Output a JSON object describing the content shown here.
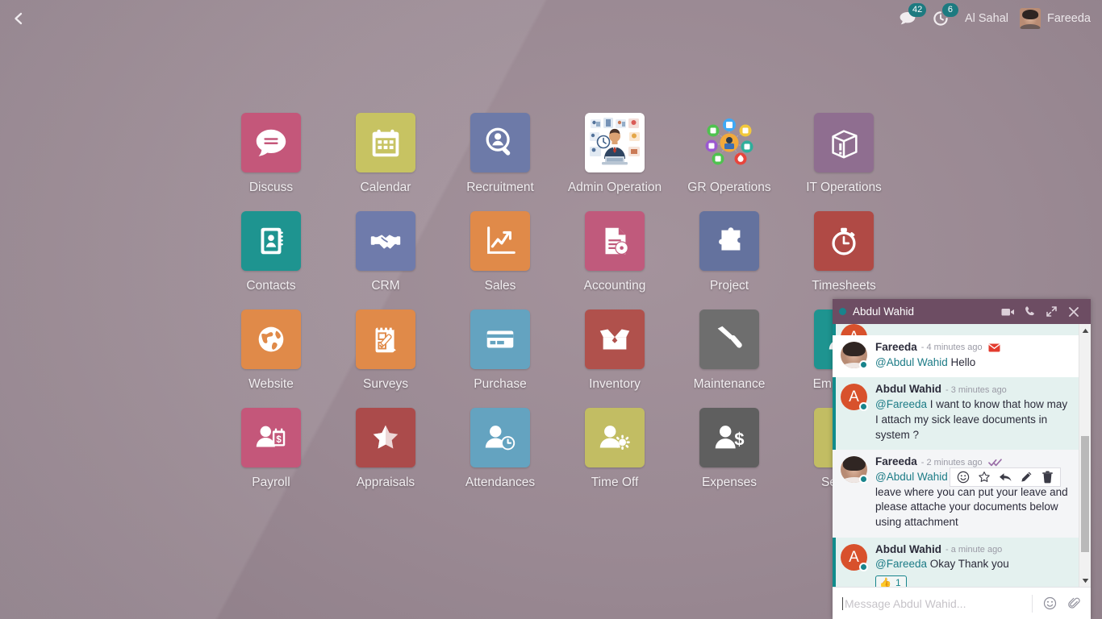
{
  "topbar": {
    "back_icon": "chevron-left-icon",
    "messages_icon": "comment-icon",
    "messages_badge": "42",
    "activities_icon": "clock-activity-icon",
    "activities_badge": "6",
    "company": "Al Sahal",
    "user": "Fareeda",
    "accent": "#1d7a80"
  },
  "apps": [
    {
      "label": "Discuss",
      "icon": "discuss-icon",
      "color": "#c4577a"
    },
    {
      "label": "Calendar",
      "icon": "calendar-icon",
      "color": "#c7c362"
    },
    {
      "label": "Recruitment",
      "icon": "recruitment-icon",
      "color": "#6d7aa8"
    },
    {
      "label": "Admin Operation",
      "icon": "admin-operation-icon",
      "color": "#ffffff"
    },
    {
      "label": "GR Operations",
      "icon": "gr-operations-icon",
      "color": "transparent"
    },
    {
      "label": "IT Operations",
      "icon": "it-operations-icon",
      "color": "#8f6e90"
    },
    {
      "label": "Contacts",
      "icon": "contacts-icon",
      "color": "#1e9490"
    },
    {
      "label": "CRM",
      "icon": "crm-icon",
      "color": "#6f7bab"
    },
    {
      "label": "Sales",
      "icon": "sales-icon",
      "color": "#e08a49"
    },
    {
      "label": "Accounting",
      "icon": "accounting-icon",
      "color": "#c05a7c"
    },
    {
      "label": "Project",
      "icon": "project-icon",
      "color": "#64729e"
    },
    {
      "label": "Timesheets",
      "icon": "timesheets-icon",
      "color": "#b04a45"
    },
    {
      "label": "Website",
      "icon": "website-icon",
      "color": "#e08a49"
    },
    {
      "label": "Surveys",
      "icon": "surveys-icon",
      "color": "#e08a49"
    },
    {
      "label": "Purchase",
      "icon": "purchase-icon",
      "color": "#64a3c0"
    },
    {
      "label": "Inventory",
      "icon": "inventory-icon",
      "color": "#b0514c"
    },
    {
      "label": "Maintenance",
      "icon": "maintenance-icon",
      "color": "#6e6e6e"
    },
    {
      "label": "Employees",
      "icon": "employees-icon",
      "color": "#1e9490"
    },
    {
      "label": "Payroll",
      "icon": "payroll-icon",
      "color": "#c4577a"
    },
    {
      "label": "Appraisals",
      "icon": "appraisals-icon",
      "color": "#ab4b4b"
    },
    {
      "label": "Attendances",
      "icon": "attendances-icon",
      "color": "#64a3c0"
    },
    {
      "label": "Time Off",
      "icon": "time-off-icon",
      "color": "#c2bd63"
    },
    {
      "label": "Expenses",
      "icon": "expenses-icon",
      "color": "#5f5f5f"
    },
    {
      "label": "Settings",
      "icon": "settings-icon",
      "color": "#c2bd63"
    }
  ],
  "chat": {
    "title": "Abdul Wahid",
    "status": "online",
    "header_buttons": [
      "video-camera-icon",
      "phone-icon",
      "expand-icon",
      "close-icon"
    ],
    "messages": [
      {
        "author": "Fareeda",
        "time": "- 4 minutes ago",
        "mention": "@Abdul Wahid",
        "text": " Hello",
        "side": "me",
        "has_envelope": true,
        "reaction": null
      },
      {
        "author": "Abdul Wahid",
        "time": "- 3 minutes ago",
        "mention": "@Fareeda",
        "text": " I want to know that how may I attach my sick leave documents in system ?",
        "side": "them",
        "has_envelope": false,
        "reaction": null
      },
      {
        "author": "Fareeda",
        "time": "- 2 minutes ago",
        "mention": "@Abdul Wahid",
        "text": " You may go to your leave where you can put your leave and please attache your documents below using attachment",
        "side": "grey",
        "has_envelope": false,
        "has_check": true,
        "reaction": null
      },
      {
        "author": "Abdul Wahid",
        "time": "- a minute ago",
        "mention": "@Fareeda",
        "text": " Okay Thank you",
        "side": "them",
        "has_envelope": false,
        "reaction": {
          "emoji": "👍",
          "count": "1"
        }
      }
    ],
    "toolbar": [
      "add-reaction-icon",
      "mark-todo-star-icon",
      "reply-icon",
      "edit-pencil-icon",
      "delete-trash-icon"
    ],
    "composer": {
      "placeholder": "Message Abdul Wahid...",
      "value": "",
      "emoji_icon": "emoji-icon",
      "attachment_icon": "paperclip-icon"
    }
  }
}
